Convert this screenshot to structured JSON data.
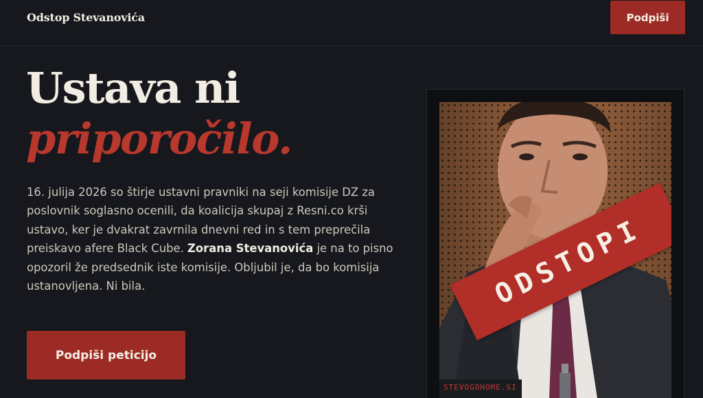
{
  "header": {
    "brand": "Odstop Stevanovića",
    "sign_button": "Podpiši"
  },
  "hero": {
    "title_line1": "Ustava ni",
    "title_line2": "priporočilo.",
    "body_part1": "16. julija 2026 so štirje ustavni pravniki na seji komisije DZ za poslovnik soglasno ocenili, da koalicija skupaj z Resni.co krši ustavo, ker je dvakrat zavrnila dnevni red in s tem preprečila preiskavo afere Black Cube. ",
    "body_bold": "Zorana Stevanovića",
    "body_part2": " je na to pisno opozoril že predsednik iste komisije. Obljubil je, da bo komisija ustanovljena. Ni bila.",
    "cta_button": "Podpiši peticijo"
  },
  "poster": {
    "stamp_text": "ODSTOPI",
    "url_text": "STEVOGOHOME.SI"
  },
  "colors": {
    "background": "#16181d",
    "accent": "#9c2b25",
    "accent_text": "#b9382d"
  }
}
